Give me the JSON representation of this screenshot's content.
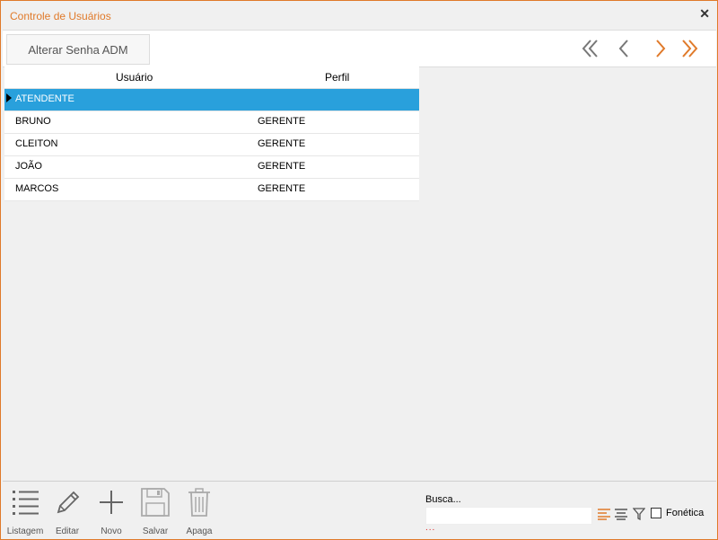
{
  "window": {
    "title": "Controle de Usuários",
    "close_symbol": "✕"
  },
  "toolbar": {
    "senha_label": "Alterar Senha ADM"
  },
  "grid": {
    "headers": {
      "usuario": "Usuário",
      "perfil": "Perfil"
    },
    "rows": [
      {
        "usuario": "ATENDENTE",
        "perfil": ""
      },
      {
        "usuario": "BRUNO",
        "perfil": "GERENTE"
      },
      {
        "usuario": "CLEITON",
        "perfil": "GERENTE"
      },
      {
        "usuario": "JOÃO",
        "perfil": "GERENTE"
      },
      {
        "usuario": "MARCOS",
        "perfil": "GERENTE"
      }
    ]
  },
  "bottom": {
    "tools": {
      "listagem": "Listagem",
      "editar": "Editar",
      "novo": "Novo",
      "salvar": "Salvar",
      "apaga": "Apaga"
    },
    "busca_label": "Busca...",
    "busca_value": "",
    "dots": "...",
    "fonetica": "Fonética"
  },
  "colors": {
    "accent": "#e07a2a",
    "selection": "#29a0dc"
  }
}
